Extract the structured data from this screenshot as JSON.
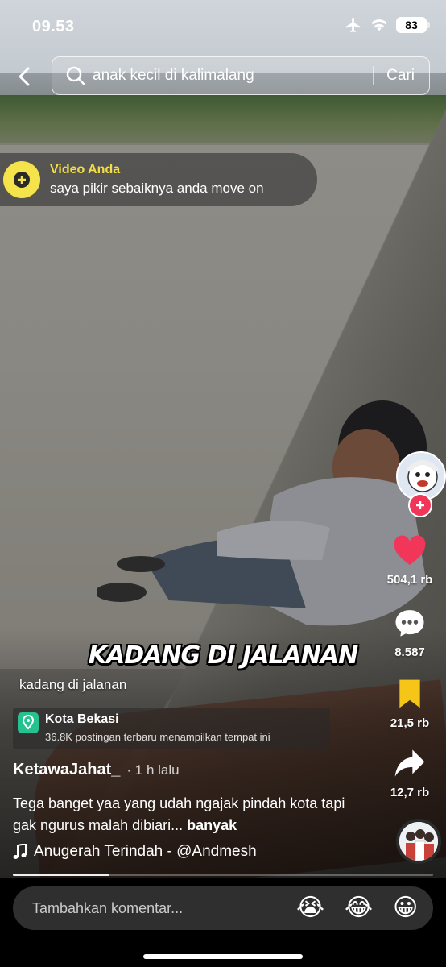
{
  "status_bar": {
    "time": "09.53",
    "battery": "83"
  },
  "search": {
    "query": "anak kecil di kalimalang",
    "button_label": "Cari"
  },
  "video_anda": {
    "title": "Video Anda",
    "subtitle": "saya pikir sebaiknya anda move on"
  },
  "video": {
    "overlay_caption": "KADANG DI JALANAN",
    "small_caption": "kadang di jalanan"
  },
  "location": {
    "name": "Kota Bekasi",
    "detail": "36.8K postingan terbaru menampilkan tempat ini"
  },
  "post": {
    "author": "KetawaJahat_",
    "time_ago": "· 1 h lalu",
    "description": "Tega banget yaa yang udah ngajak pindah kota tapi gak ngurus malah dibiari...",
    "more_label": "banyak",
    "music": "Anugerah Terindah - @Andmesh",
    "progress_fraction": 0.23
  },
  "actions": {
    "likes": "504,1 rb",
    "comments": "8.587",
    "saves": "21,5 rb",
    "shares": "12,7 rb"
  },
  "comment_bar": {
    "placeholder": "Tambahkan komentar...",
    "emojis": [
      "😭",
      "😂",
      "😀"
    ]
  },
  "colors": {
    "like": "#f1365a",
    "save": "#f5c518",
    "video_anda_accent": "#f3df44",
    "location_icon": "#25c28f"
  },
  "icons": [
    "back-arrow-icon",
    "search-icon",
    "airplane-icon",
    "wifi-icon",
    "battery-icon",
    "plus-icon",
    "heart-icon",
    "comment-icon",
    "bookmark-icon",
    "share-icon",
    "location-pin-icon",
    "music-note-icon"
  ]
}
